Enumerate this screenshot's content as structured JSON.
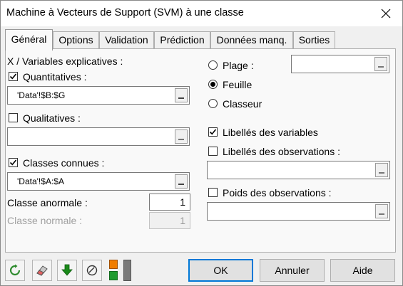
{
  "window": {
    "title": "Machine à Vecteurs de Support (SVM) à une classe",
    "close_icon": "close-icon"
  },
  "tabs": [
    {
      "label": "Général",
      "active": true
    },
    {
      "label": "Options"
    },
    {
      "label": "Validation"
    },
    {
      "label": "Prédiction"
    },
    {
      "label": "Données manq."
    },
    {
      "label": "Sorties"
    }
  ],
  "general": {
    "x_section_label": "X / Variables explicatives :",
    "quantitatives": {
      "label": "Quantitatives :",
      "checked": true,
      "value": "'Data'!$B:$G"
    },
    "qualitatives": {
      "label": "Qualitatives :",
      "checked": false,
      "value": ""
    },
    "known_classes": {
      "label": "Classes connues :",
      "checked": true,
      "value": "'Data'!$A:$A"
    },
    "abnormal_class": {
      "label": "Classe anormale :",
      "value": "1"
    },
    "normal_class": {
      "label": "Classe normale :",
      "value": "1"
    },
    "range_options": {
      "plage": {
        "label": "Plage :",
        "selected": false,
        "value": ""
      },
      "feuille": {
        "label": "Feuille",
        "selected": true
      },
      "classeur": {
        "label": "Classeur",
        "selected": false
      }
    },
    "variable_labels": {
      "label": "Libellés des variables",
      "checked": true
    },
    "observation_labels": {
      "label": "Libellés des observations :",
      "checked": false,
      "value": ""
    },
    "observation_weights": {
      "label": "Poids des observations :",
      "checked": false,
      "value": ""
    }
  },
  "footer": {
    "ok_label": "OK",
    "cancel_label": "Annuler",
    "help_label": "Aide",
    "colors": {
      "refresh": "#2e8b2e",
      "download": "#1a8a1a",
      "orange": "#f07d00",
      "green": "#1f9a2f",
      "gray": "#7a7a7a"
    }
  }
}
